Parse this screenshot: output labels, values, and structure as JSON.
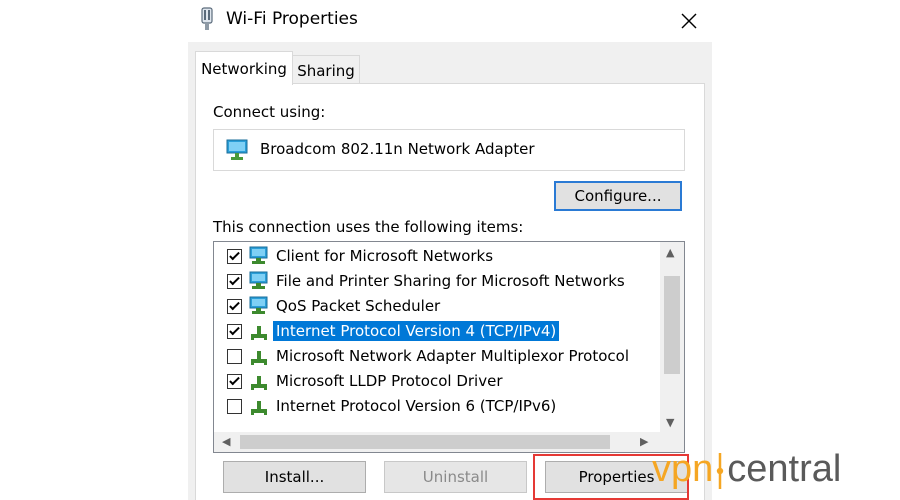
{
  "window": {
    "title": "Wi-Fi Properties"
  },
  "tabs": [
    {
      "label": "Networking",
      "active": true
    },
    {
      "label": "Sharing",
      "active": false
    }
  ],
  "connect_using": {
    "label": "Connect using:",
    "adapter": "Broadcom 802.11n Network Adapter",
    "configure_label": "Configure..."
  },
  "items_section": {
    "label": "This connection uses the following items:",
    "items": [
      {
        "label": "Client for Microsoft Networks",
        "checked": true,
        "icon": "network-client-icon"
      },
      {
        "label": "File and Printer Sharing for Microsoft Networks",
        "checked": true,
        "icon": "network-service-icon"
      },
      {
        "label": "QoS Packet Scheduler",
        "checked": true,
        "icon": "network-service-icon"
      },
      {
        "label": "Internet Protocol Version 4 (TCP/IPv4)",
        "checked": true,
        "icon": "network-protocol-icon",
        "selected": true
      },
      {
        "label": "Microsoft Network Adapter Multiplexor Protocol",
        "checked": false,
        "icon": "network-protocol-icon"
      },
      {
        "label": "Microsoft LLDP Protocol Driver",
        "checked": true,
        "icon": "network-protocol-icon"
      },
      {
        "label": "Internet Protocol Version 6 (TCP/IPv6)",
        "checked": false,
        "icon": "network-protocol-icon"
      }
    ]
  },
  "buttons": {
    "install": "Install...",
    "uninstall": "Uninstall",
    "properties": "Properties"
  },
  "watermark": {
    "part1": "vpn",
    "part2": "central"
  },
  "colors": {
    "selection": "#0078d7",
    "highlight": "#e53935",
    "accent": "#f5a623"
  }
}
